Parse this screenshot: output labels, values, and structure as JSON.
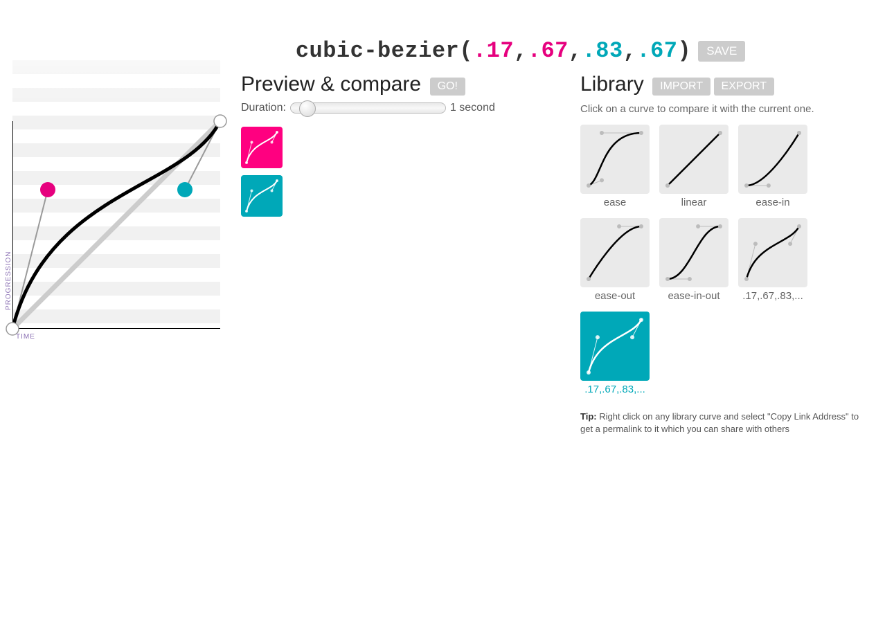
{
  "header": {
    "func_name": "cubic-bezier",
    "open": "(",
    "p1": ".17",
    "p2": ".67",
    "p3": ".83",
    "p4": ".67",
    "comma": ",",
    "close": ")",
    "save_label": "SAVE"
  },
  "curve": {
    "p1x": 0.17,
    "p1y": 0.67,
    "p2x": 0.83,
    "p2y": 0.67,
    "axis_time": "TIME",
    "axis_progression": "PROGRESSION",
    "colors": {
      "p1": "#e6007e",
      "p2": "#00a8b8",
      "curve": "#000000",
      "diag": "#cccccc"
    }
  },
  "preview": {
    "title": "Preview & compare",
    "go_label": "GO!",
    "duration_label": "Duration:",
    "duration_value": "1 second"
  },
  "library": {
    "title": "Library",
    "import_label": "IMPORT",
    "export_label": "EXPORT",
    "subtitle": "Click on a curve to compare it with the current one.",
    "items": [
      {
        "label": "ease",
        "b": [
          0.25,
          0.1,
          0.25,
          1
        ],
        "selected": false
      },
      {
        "label": "linear",
        "b": [
          0,
          0,
          1,
          1
        ],
        "selected": false
      },
      {
        "label": "ease-in",
        "b": [
          0.42,
          0,
          1,
          1
        ],
        "selected": false
      },
      {
        "label": "ease-out",
        "b": [
          0,
          0,
          0.58,
          1
        ],
        "selected": false
      },
      {
        "label": "ease-in-out",
        "b": [
          0.42,
          0,
          0.58,
          1
        ],
        "selected": false
      },
      {
        "label": ".17,.67,.83,...",
        "b": [
          0.17,
          0.67,
          0.83,
          0.67
        ],
        "selected": false
      },
      {
        "label": ".17,.67,.83,...",
        "b": [
          0.17,
          0.67,
          0.83,
          0.67
        ],
        "selected": true
      }
    ],
    "tip_label": "Tip:",
    "tip_text": " Right click on any library curve and select \"Copy Link Address\" to get a permalink to it which you can share with others"
  }
}
